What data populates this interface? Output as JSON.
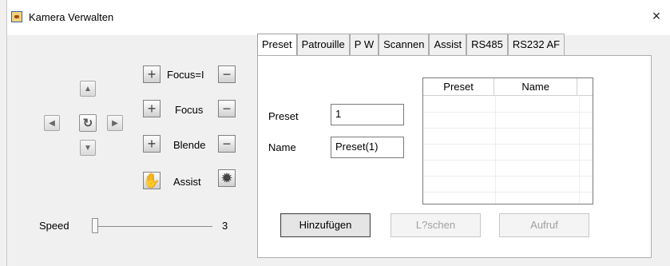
{
  "window": {
    "title": "Kamera Verwalten",
    "close_glyph": "×"
  },
  "left": {
    "focus_label_1": "Focus=I",
    "focus_label_2": "Focus",
    "iris_label": "Blende",
    "assist_label": "Assist",
    "speed_label": "Speed",
    "speed_value": "3",
    "speed_level": 0.0
  },
  "tabs": [
    {
      "label": "Preset"
    },
    {
      "label": "Patrouille"
    },
    {
      "label": "P W"
    },
    {
      "label": "Scannen"
    },
    {
      "label": "Assist"
    },
    {
      "label": "RS485"
    },
    {
      "label": "RS232 AF"
    }
  ],
  "preset_panel": {
    "preset_label": "Preset",
    "preset_value": "1",
    "name_label": "Name",
    "name_value": "Preset(1)",
    "list_headers": [
      "Preset",
      "Name"
    ],
    "buttons": {
      "add": "Hinzufügen",
      "delete": "L?schen",
      "call": "Aufruf"
    }
  },
  "icons": {
    "up": "triangle-up-icon",
    "left": "triangle-left-icon",
    "reset": "refresh-icon",
    "right": "triangle-right-icon",
    "down": "triangle-down-icon",
    "plus": "plus-icon",
    "minus": "minus-icon",
    "assist": "hand-icon",
    "light": "bulb-icon"
  },
  "colors": {
    "window_bg": "#f0f0f0",
    "panel_bg": "#ffffff",
    "disabled_text": "#a0a0a0"
  }
}
